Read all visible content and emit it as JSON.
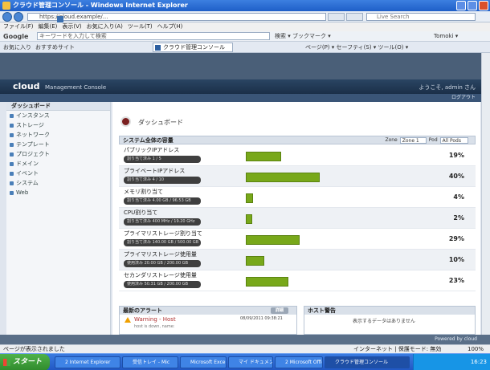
{
  "browser": {
    "title": "クラウド管理コンソール - Windows Internet Explorer",
    "address": "https://cloud.example/...",
    "search_placeholder": "Live Search",
    "menu": [
      "ファイル(F)",
      "編集(E)",
      "表示(V)",
      "お気に入り(A)",
      "ツール(T)",
      "ヘルプ(H)"
    ],
    "google_label": "Google",
    "google_input": "キーワードを入力して検索",
    "google_search": "検索 ▾  ブックマーク ▾",
    "google_right": "Tomoki ▾",
    "favorites": "お気に入り",
    "fav_extra": "おすすめサイト",
    "tab_title": "クラウド管理コンソール",
    "commands": "ページ(P) ▾  セーフティ(S) ▾  ツール(O) ▾"
  },
  "app": {
    "brand": "cloud",
    "subtitle": "Management Console",
    "user": "ようこそ, admin さん",
    "logout": "ログアウト"
  },
  "sidebar": {
    "header": "ダッシュボード",
    "items": [
      {
        "label": "インスタンス"
      },
      {
        "label": "ストレージ"
      },
      {
        "label": "ネットワーク"
      },
      {
        "label": "テンプレート"
      },
      {
        "label": "プロジェクト"
      },
      {
        "label": "ドメイン"
      },
      {
        "label": "イベント"
      },
      {
        "label": "システム"
      },
      {
        "label": "Web"
      }
    ]
  },
  "main": {
    "page_title": "ダッシュボード",
    "panel_title": "システム全体の容量",
    "panel_zone_label": "Zone",
    "panel_zone_value": "Zone 1",
    "panel_pod_label": "Pod",
    "panel_pod_value": "All Pods",
    "rows": [
      {
        "label": "パブリックIPアドレス",
        "detail": "割り当て済み 1 / 5",
        "percent": 19,
        "percent_text": "19%"
      },
      {
        "label": "プライベートIPアドレス",
        "detail": "割り当て済み 4 / 10",
        "percent": 40,
        "percent_text": "40%"
      },
      {
        "label": "メモリ割り当て",
        "detail": "割り当て済み 4.00 GB / 96.53 GB",
        "percent": 4,
        "percent_text": "4%"
      },
      {
        "label": "CPU割り当て",
        "detail": "割り当て済み 400 MHz / 19.20 GHz",
        "percent": 2,
        "percent_text": "2%"
      },
      {
        "label": "プライマリストレージ割り当て",
        "detail": "割り当て済み 140.00 GB / 500.00 GB",
        "percent": 29,
        "percent_text": "29%"
      },
      {
        "label": "プライマリストレージ使用量",
        "detail": "使用済み 20.00 GB / 200.00 GB",
        "percent": 10,
        "percent_text": "10%"
      },
      {
        "label": "セカンダリストレージ使用量",
        "detail": "使用済み 50.31 GB / 200.00 GB",
        "percent": 23,
        "percent_text": "23%"
      }
    ],
    "alerts": {
      "title": "最新のアラート",
      "more_button": "詳細",
      "item_title": "Warning - Host",
      "item_detail": "host is down, name: ",
      "item_time": "08/09/2011 09:38:21"
    },
    "jobs": {
      "title": "ホスト警告",
      "empty": "表示するデータはありません"
    }
  },
  "footer": {
    "powered": "Powered by cloud"
  },
  "status": {
    "left": "ページが表示されました",
    "mid": "インターネット | 保護モード: 無効",
    "zoom": "100%"
  },
  "taskbar": {
    "start": "スタート",
    "buttons": [
      "2 Internet Explorer",
      "受信トレイ - Mic",
      "Microsoft Excel",
      "マイ ドキュメント",
      "2 Microsoft Office",
      "クラウド管理コンソール"
    ],
    "tray_time": "16:23"
  }
}
